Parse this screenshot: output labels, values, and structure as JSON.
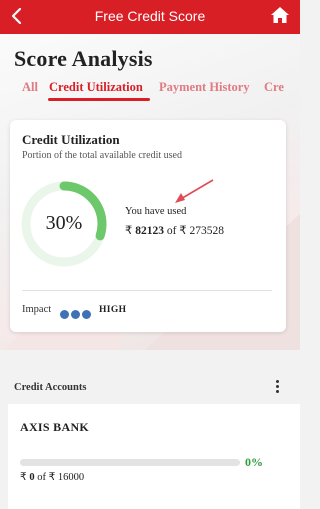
{
  "header": {
    "title": "Free Credit Score"
  },
  "page": {
    "title": "Score Analysis"
  },
  "tabs": [
    {
      "label": "All"
    },
    {
      "label": "Credit Utilization"
    },
    {
      "label": "Payment History"
    },
    {
      "label": "Cre"
    }
  ],
  "active_tab": "Credit Utilization",
  "utilization": {
    "title": "Credit Utilization",
    "subtitle": "Portion of the total available credit used",
    "percent_text": "30%",
    "percent": 30,
    "used_label": "You have used",
    "currency": "₹",
    "used_amount": "82123",
    "of_text": "of",
    "total_amount": "273528",
    "impact_label": "Impact",
    "impact_level": "HIGH",
    "impact_dots": 3
  },
  "credit_accounts": {
    "heading": "Credit Accounts",
    "accounts": [
      {
        "name": "AXIS BANK",
        "percent_text": "0%",
        "percent": 0,
        "used": "0",
        "of_text": "of",
        "limit": "16000"
      }
    ]
  },
  "colors": {
    "brand": "#d81f26",
    "ring_progress": "#6cc86a",
    "ring_track": "#eaf6ea",
    "impact_dot": "#3f72b5",
    "positive": "#2e9a3a"
  },
  "icons": {
    "back": "chevron-left-icon",
    "home": "home-icon",
    "menu": "kebab-menu-icon"
  }
}
